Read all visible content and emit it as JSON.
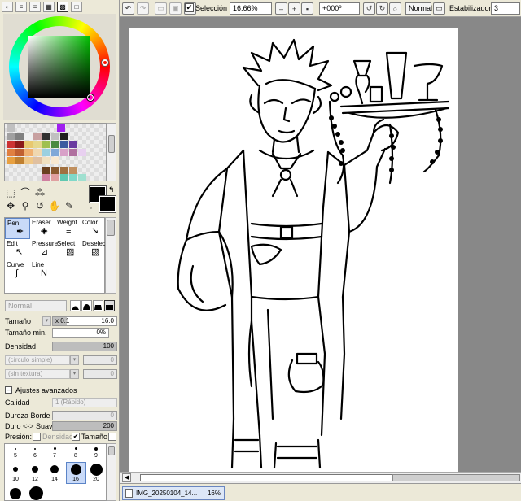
{
  "toolbar": {
    "selection_label": "Selección",
    "selection_checked": true,
    "zoom_value": "16.66%",
    "rotation_value": "+000º",
    "blend_mode": "Normal",
    "stabilizer_label": "Estabilizador",
    "stabilizer_value": "3"
  },
  "color_palette": {
    "swatches_row1": [
      "#c0c0c0",
      "#a020f0"
    ],
    "accent": "#00c000"
  },
  "tools": {
    "row1": [
      "Pen",
      "Eraser",
      "Weight",
      "Color"
    ],
    "row2": [
      "Edit",
      "Pressure",
      "Select",
      "Deselect"
    ],
    "row3": [
      "Curve",
      "Line"
    ],
    "active": "Pen"
  },
  "brush": {
    "mode": "Normal",
    "size_label": "Tamaño",
    "size_mult": "x 0.1",
    "size_value": "16.0",
    "min_size_label": "Tamaño min.",
    "min_size_value": "0%",
    "density_label": "Densidad",
    "density_value": "100",
    "shape_dropdown": "(círculo simple)",
    "shape_value": "0",
    "texture_dropdown": "(sin textura)",
    "texture_value": "0",
    "advanced_label": "Ajustes avanzados",
    "quality_label": "Calidad",
    "quality_value": "1 (Rápido)",
    "edge_label": "Dureza Borde",
    "edge_value": "0",
    "hard_soft_label": "Duro <-> Suave",
    "hard_soft_value": "200",
    "pressure_label": "Presión:",
    "pressure_density_label": "Densidad",
    "pressure_size_label": "Tamaño",
    "pressure_size_checked": true,
    "pressure_density_checked": false
  },
  "size_presets": [
    "5",
    "6",
    "7",
    "8",
    "9",
    "10",
    "12",
    "14",
    "16",
    "20"
  ],
  "size_preset_active": "16",
  "document": {
    "tab_name": "IMG_20250104_14...",
    "tab_zoom": "16%"
  }
}
